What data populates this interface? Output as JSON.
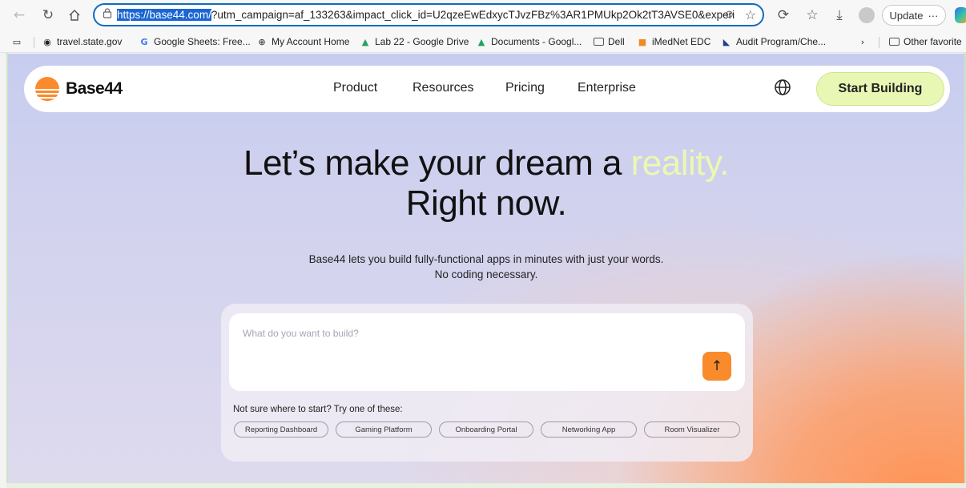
{
  "browser": {
    "address_url_selected": "https://base44.com/",
    "address_url_rest": "?utm_campaign=af_133263&impact_click_id=U2qzeEwEdxycTJvzFBz%3AR1PMUkp2Ok2tT3AVSE0&experi",
    "update_label": "Update",
    "update_more": "···"
  },
  "bookmarks": [
    {
      "label": "travel.state.gov",
      "icon": "seal-icon"
    },
    {
      "label": "Google Sheets: Free...",
      "icon": "google-icon"
    },
    {
      "label": "My Account Home",
      "icon": "globe-icon"
    },
    {
      "label": "Lab 22 - Google Drive",
      "icon": "google-drive-icon"
    },
    {
      "label": "Documents - Googl...",
      "icon": "google-drive-icon"
    },
    {
      "label": "Dell",
      "icon": "folder-icon"
    },
    {
      "label": "iMedNet EDC",
      "icon": "cube-icon"
    },
    {
      "label": "Audit Program/Che...",
      "icon": "triangle-icon"
    }
  ],
  "bookmarks_other": "Other favorite",
  "site": {
    "logo_text": "Base44",
    "nav": [
      "Product",
      "Resources",
      "Pricing",
      "Enterprise"
    ],
    "cta_label": "Start Building",
    "hero_line1_main": "Let’s make your dream a ",
    "hero_line1_accent": "reality.",
    "hero_line2": "Right now.",
    "subtitle_line1": "Base44 lets you build fully-functional apps in minutes with just your words.",
    "subtitle_line2": "No coding necessary.",
    "prompt_placeholder": "What do you want to build?",
    "hint": "Not sure where to start? Try one of these:",
    "suggestions": [
      "Reporting Dashboard",
      "Gaming Platform",
      "Onboarding Portal",
      "Networking App",
      "Room Visualizer"
    ]
  },
  "colors": {
    "accent_orange": "#f98b2c",
    "cta_bg": "#e9f7b4",
    "hero_accent": "#eef7b1",
    "address_focus": "#0f6cbd"
  }
}
